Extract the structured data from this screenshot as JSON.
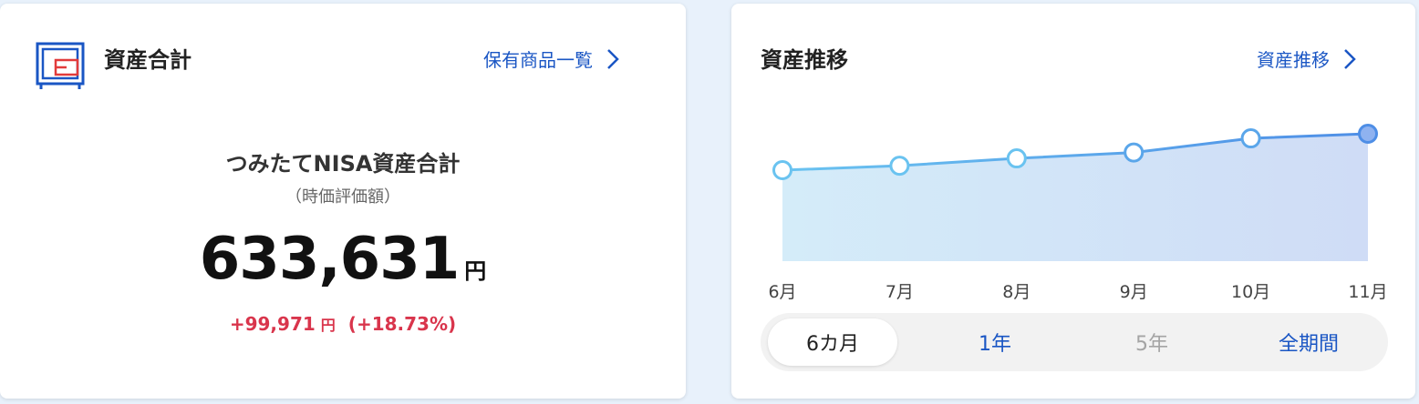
{
  "left_card": {
    "title": "資産合計",
    "link_label": "保有商品一覧",
    "nisa_title": "つみたてNISA資産合計",
    "nisa_subtitle": "（時価評価額）",
    "total_value": "633,631",
    "total_unit": "円",
    "gain_value": "+99,971",
    "gain_unit": "円",
    "gain_percent": "(+18.73%)"
  },
  "right_card": {
    "title": "資産推移",
    "link_label": "資産推移"
  },
  "range_tabs": [
    {
      "label": "6カ月",
      "state": "active"
    },
    {
      "label": "1年",
      "state": "enabled"
    },
    {
      "label": "5年",
      "state": "disabled"
    },
    {
      "label": "全期間",
      "state": "enabled"
    }
  ],
  "colors": {
    "accent_blue": "#1a56c4",
    "gain_red": "#d9354c",
    "line_start": "#6ac3f0",
    "line_end": "#4e8ee6"
  },
  "chart_data": {
    "type": "area",
    "categories": [
      "6月",
      "7月",
      "8月",
      "9月",
      "10月",
      "11月"
    ],
    "series": [
      {
        "values": [
          510000,
          525000,
          550000,
          570000,
          618000,
          633631
        ]
      }
    ]
  }
}
